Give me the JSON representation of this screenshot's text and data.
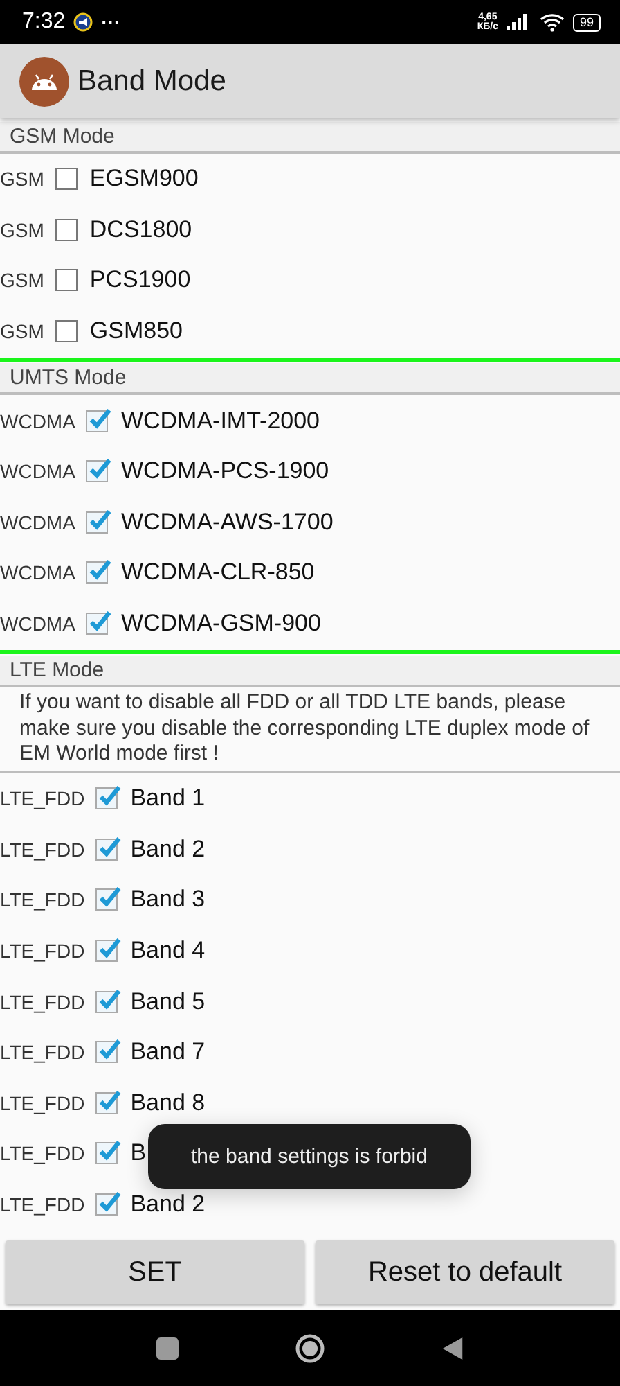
{
  "status_bar": {
    "time": "7:32",
    "overflow": "···",
    "speed_value": "4,65",
    "speed_unit": "КБ/с",
    "battery": "99"
  },
  "app_bar": {
    "title": "Band Mode"
  },
  "sections": [
    {
      "title": "GSM Mode",
      "bands": [
        {
          "type": "GSM",
          "name": "EGSM900",
          "checked": false
        },
        {
          "type": "GSM",
          "name": "DCS1800",
          "checked": false
        },
        {
          "type": "GSM",
          "name": "PCS1900",
          "checked": false
        },
        {
          "type": "GSM",
          "name": "GSM850",
          "checked": false
        }
      ]
    },
    {
      "title": "UMTS Mode",
      "bands": [
        {
          "type": "WCDMA",
          "name": "WCDMA-IMT-2000",
          "checked": true
        },
        {
          "type": "WCDMA",
          "name": "WCDMA-PCS-1900",
          "checked": true
        },
        {
          "type": "WCDMA",
          "name": "WCDMA-AWS-1700",
          "checked": true
        },
        {
          "type": "WCDMA",
          "name": "WCDMA-CLR-850",
          "checked": true
        },
        {
          "type": "WCDMA",
          "name": "WCDMA-GSM-900",
          "checked": true
        }
      ]
    },
    {
      "title": "LTE Mode",
      "note": "If you want to disable all FDD or all TDD LTE bands, please make sure you disable the corresponding LTE duplex mode of EM World mode first !",
      "bands": [
        {
          "type": "LTE_FDD",
          "name": "Band 1",
          "checked": true
        },
        {
          "type": "LTE_FDD",
          "name": "Band 2",
          "checked": true
        },
        {
          "type": "LTE_FDD",
          "name": "Band 3",
          "checked": true
        },
        {
          "type": "LTE_FDD",
          "name": "Band 4",
          "checked": true
        },
        {
          "type": "LTE_FDD",
          "name": "Band 5",
          "checked": true
        },
        {
          "type": "LTE_FDD",
          "name": "Band 7",
          "checked": true
        },
        {
          "type": "LTE_FDD",
          "name": "Band 8",
          "checked": true
        },
        {
          "type": "LTE_FDD",
          "name": "B",
          "checked": true
        },
        {
          "type": "LTE_FDD",
          "name": "Band 2",
          "checked": true
        }
      ]
    }
  ],
  "toast": "the band settings is forbid",
  "buttons": [
    "SET",
    "Reset to default"
  ]
}
